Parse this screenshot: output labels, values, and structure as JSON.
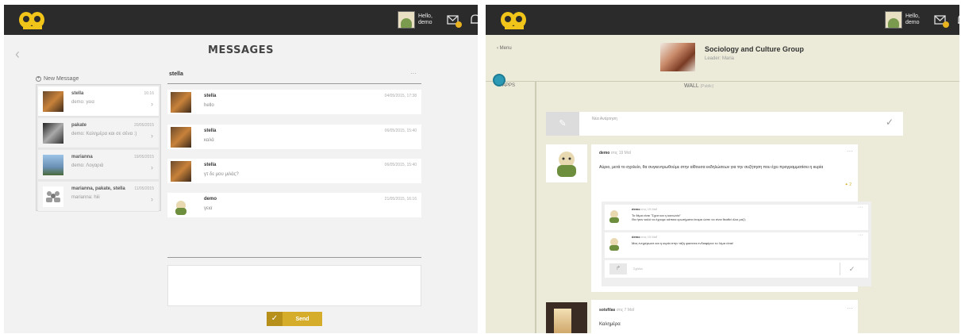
{
  "left": {
    "header": {
      "hello": "Hello, demo"
    },
    "page_title": "MESSAGES",
    "new_message": "New Message",
    "conversations": [
      {
        "name": "stella",
        "preview": "demo: γεια",
        "time": "16:16"
      },
      {
        "name": "pakate",
        "preview": "demo: Καλημέρα και σε σένα :)",
        "time": "20/05/2015"
      },
      {
        "name": "marianna",
        "preview": "demo: Λογαριά",
        "time": "19/05/2015"
      },
      {
        "name": "marianna, pakate, stella",
        "preview": "marianna: hiii",
        "time": "11/05/2015"
      }
    ],
    "thread": {
      "title": "stella",
      "messages": [
        {
          "name": "stella",
          "text": "hello",
          "time": "04/05/2015, 17:38"
        },
        {
          "name": "stella",
          "text": "καλά",
          "time": "06/05/2015, 15:40"
        },
        {
          "name": "stella",
          "text": "γτ δε μου μιλάς?",
          "time": "06/05/2015, 15:40"
        },
        {
          "name": "demo",
          "text": "γεια",
          "time": "21/05/2015, 16:16"
        }
      ]
    },
    "send_label": "Send"
  },
  "right": {
    "header": {
      "hello": "Hello, demo"
    },
    "back": "Menu",
    "group_title": "Sociology and Culture Group",
    "group_leader": "Leader: Maria",
    "apps_label": "APPS",
    "wall_label": "WALL",
    "wall_sub": "(Public)",
    "new_post_placeholder": "Νέα Ανάρτηση",
    "post": {
      "author": "demo",
      "time": "στις 19 Μαΐ",
      "text": "Αύριο, μετά το σχολείο, θα συγκεντρωθούμε στην αίθουσα εκδηλώσεων για την συζήτηση που έχει προγραμματίσει η κυρία",
      "likes": "2",
      "comments": [
        {
          "author": "demo",
          "time": "στις 19 Μαΐ",
          "line1": "Το θέμα είναι \"Σχεσ και η κοινωνία\"",
          "line2": "Θα ήταν καλό να έχουμε κάποια ερωτήματα έτοιμα ώστε να είναι θεαθεί όλοι μαζί;"
        },
        {
          "author": "demo",
          "time": "στις 19 Μαΐ",
          "line1": "Μας ενημέρωσε και η κυρία στην τάξη φαινεται ενδιαφέρον το λέμα είναι!",
          "line2": ""
        }
      ],
      "comment_placeholder": "Σχόλιο"
    },
    "post2": {
      "author": "sotsfilas",
      "time": "στις 7 Μαΐ",
      "text": "Καλημέρα"
    }
  }
}
